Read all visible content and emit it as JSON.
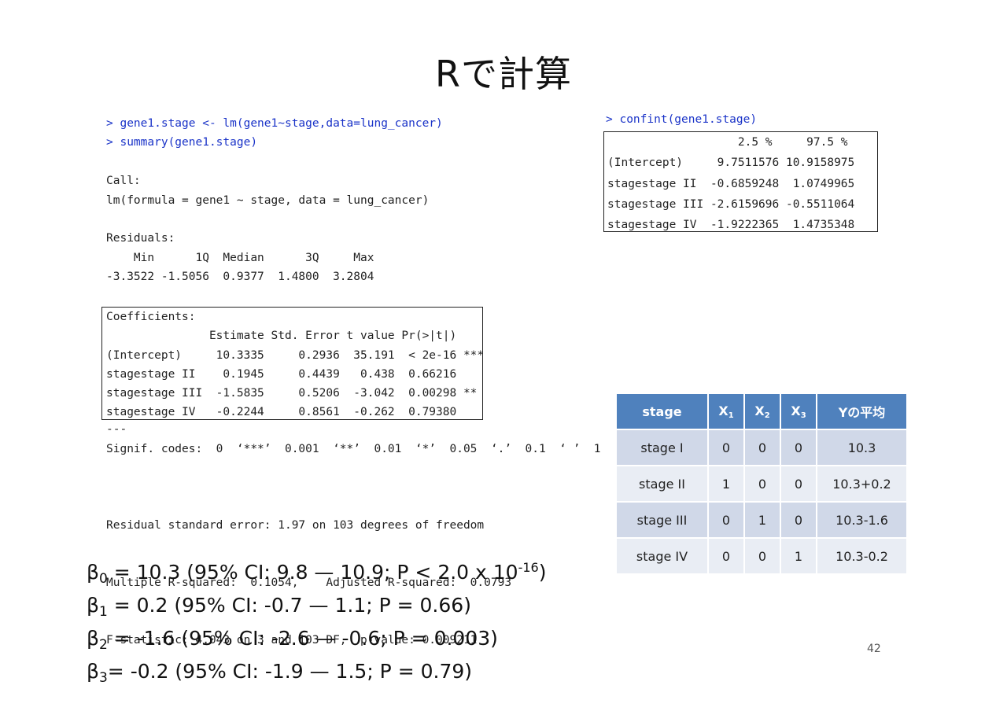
{
  "title": "Rで計算",
  "console": {
    "cmd1": "> gene1.stage <- lm(gene1~stage,data=lung_cancer)",
    "cmd2": "> summary(gene1.stage)",
    "call_label": "Call:",
    "call": "lm(formula = gene1 ~ stage, data = lung_cancer)",
    "residuals_label": "Residuals:",
    "residuals_header": "    Min      1Q  Median      3Q     Max ",
    "residuals_values": "-3.3522 -1.5056  0.9377  1.4800  3.2804 "
  },
  "coefficients": {
    "label": "Coefficients:",
    "header": "               Estimate Std. Error t value Pr(>|t|)    ",
    "rows": [
      "(Intercept)     10.3335     0.2936  35.191  < 2e-16 ***",
      "stagestage II    0.1945     0.4439   0.438  0.66216    ",
      "stagestage III  -1.5835     0.5206  -3.042  0.00298 ** ",
      "stagestage IV   -0.2244     0.8561  -0.262  0.79380    "
    ]
  },
  "dashes": "---",
  "signif": "Signif. codes:  0  ‘***’  0.001  ‘**’  0.01  ‘*’  0.05  ‘.’  0.1  ‘ ’  1",
  "model_stats": [
    "Residual standard error: 1.97 on 103 degrees of freedom",
    "Multiple R-squared:  0.1054,    Adjusted R-squared:  0.0793 ",
    "F-statistic: 4.043 on 3 and 103 DF,  p-value: 0.009211"
  ],
  "confint": {
    "cmd": "> confint(gene1.stage)",
    "header": "                   2.5 %     97.5 %",
    "rows": [
      "(Intercept)     9.7511576 10.9158975",
      "stagestage II  -0.6859248  1.0749965",
      "stagestage III -2.6159696 -0.5511064",
      "stagestage IV  -1.9222365  1.4735348"
    ]
  },
  "stage_table": {
    "headers": [
      "stage",
      "X",
      "X",
      "X",
      "Yの平均"
    ],
    "header_subs": [
      "",
      "1",
      "2",
      "3",
      ""
    ],
    "rows": [
      [
        "stage I",
        "0",
        "0",
        "0",
        "10.3"
      ],
      [
        "stage II",
        "1",
        "0",
        "0",
        "10.3+0.2"
      ],
      [
        "stage III",
        "0",
        "1",
        "0",
        "10.3-1.6"
      ],
      [
        "stage IV",
        "0",
        "0",
        "1",
        "10.3-0.2"
      ]
    ]
  },
  "betas": [
    {
      "sym": "β",
      "sub": "0",
      "text": " = 10.3 (95% CI: 9.8 — 10.9; P < 2.0 x 10",
      "sup": "-16",
      "tail": ")"
    },
    {
      "sym": "β",
      "sub": "1",
      "text": " = 0.2 (95% CI: -0.7 — 1.1; P = 0.66)",
      "sup": "",
      "tail": ""
    },
    {
      "sym": "β",
      "sub": "2",
      "text": " = -1.6 (95% CI: -2.6 — -0.6; P = 0.003)",
      "sup": "",
      "tail": ""
    },
    {
      "sym": "β",
      "sub": "3",
      "text": "= -0.2 (95% CI: -1.9 — 1.5; P = 0.79)",
      "sup": "",
      "tail": ""
    }
  ],
  "page_number": "42"
}
